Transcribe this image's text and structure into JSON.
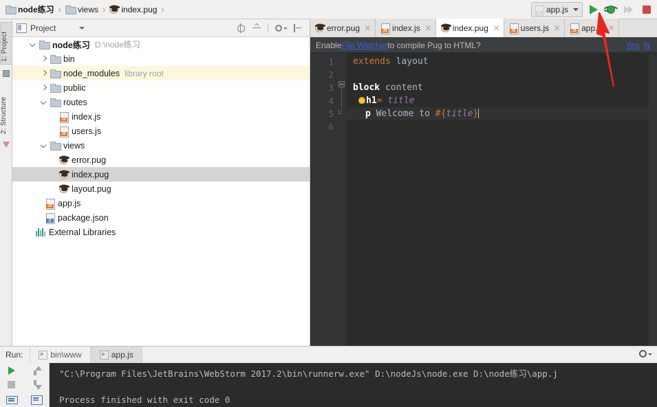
{
  "breadcrumb": {
    "items": [
      {
        "label": "node练习",
        "icon": "folder-icon",
        "bold": true
      },
      {
        "label": "views",
        "icon": "folder-icon",
        "bold": false
      },
      {
        "label": "index.pug",
        "icon": "pug-icon",
        "bold": false
      }
    ],
    "separator": "›"
  },
  "left_strip": {
    "project_tab": "1: Project",
    "structure_tab": "2: Structure"
  },
  "project_panel": {
    "title": "Project",
    "tools": [
      "locate-icon",
      "collapse-all-icon",
      "settings-gear-icon",
      "hide-icon"
    ],
    "tree": [
      {
        "label": "node练习",
        "sub": "D:\\node练习",
        "icon": "folder-icon",
        "arrow": "down",
        "indent": 0,
        "bold": true,
        "state": "normal"
      },
      {
        "label": "bin",
        "sub": "",
        "icon": "folder-icon",
        "arrow": "right",
        "indent": 1,
        "bold": false,
        "state": "normal"
      },
      {
        "label": "node_modules",
        "sub": "library root",
        "icon": "folder-icon",
        "arrow": "right",
        "indent": 1,
        "bold": false,
        "state": "highlight"
      },
      {
        "label": "public",
        "sub": "",
        "icon": "folder-icon",
        "arrow": "right",
        "indent": 1,
        "bold": false,
        "state": "normal"
      },
      {
        "label": "routes",
        "sub": "",
        "icon": "folder-icon",
        "arrow": "down",
        "indent": 1,
        "bold": false,
        "state": "normal"
      },
      {
        "label": "index.js",
        "sub": "",
        "icon": "js-icon",
        "arrow": "none",
        "indent": 2,
        "bold": false,
        "state": "normal"
      },
      {
        "label": "users.js",
        "sub": "",
        "icon": "js-icon",
        "arrow": "none",
        "indent": 2,
        "bold": false,
        "state": "normal"
      },
      {
        "label": "views",
        "sub": "",
        "icon": "folder-icon",
        "arrow": "down",
        "indent": 1,
        "bold": false,
        "state": "normal"
      },
      {
        "label": "error.pug",
        "sub": "",
        "icon": "pug-icon",
        "arrow": "none",
        "indent": 2,
        "bold": false,
        "state": "normal"
      },
      {
        "label": "index.pug",
        "sub": "",
        "icon": "pug-icon",
        "arrow": "none",
        "indent": 2,
        "bold": false,
        "state": "selected"
      },
      {
        "label": "layout.pug",
        "sub": "",
        "icon": "pug-icon",
        "arrow": "none",
        "indent": 2,
        "bold": false,
        "state": "normal"
      },
      {
        "label": "app.js",
        "sub": "",
        "icon": "js-icon",
        "arrow": "none",
        "indent": 1,
        "bold": false,
        "state": "normal"
      },
      {
        "label": "package.json",
        "sub": "",
        "icon": "json-icon",
        "arrow": "none",
        "indent": 1,
        "bold": false,
        "state": "normal"
      },
      {
        "label": "External Libraries",
        "sub": "",
        "icon": "library-icon",
        "arrow": "none",
        "indent": 0,
        "bold": false,
        "state": "normal"
      }
    ]
  },
  "run_toolbar": {
    "config_name": "app.js",
    "config_icon": "js-icon",
    "buttons": [
      {
        "name": "run-button",
        "icon": "play-icon",
        "enabled": true
      },
      {
        "name": "debug-button",
        "icon": "bug-icon",
        "enabled": true
      },
      {
        "name": "run-with-coverage-button",
        "icon": "fast-forward-icon",
        "enabled": false
      },
      {
        "name": "stop-button",
        "icon": "stop-icon",
        "enabled": true
      }
    ]
  },
  "editor": {
    "tabs": [
      {
        "label": "error.pug",
        "icon": "pug-icon",
        "active": false
      },
      {
        "label": "index.js",
        "icon": "js-icon",
        "active": false
      },
      {
        "label": "index.pug",
        "icon": "pug-icon",
        "active": true
      },
      {
        "label": "users.js",
        "icon": "js-icon",
        "active": false
      },
      {
        "label": "app.js",
        "icon": "js-icon",
        "active": false
      }
    ],
    "notification": {
      "prefix": "Enable ",
      "link": "File Watcher",
      "suffix": " to compile Pug to HTML?",
      "action_yes": "Yes",
      "action_no": "N"
    },
    "line_numbers": [
      "1",
      "2",
      "3",
      "4",
      "5",
      "6"
    ],
    "current_line": 5,
    "lines": [
      {
        "n": 1,
        "tokens": [
          {
            "t": "extends",
            "c": "kw-extends"
          },
          {
            "t": " layout",
            "c": "kw-plain"
          }
        ]
      },
      {
        "n": 2,
        "tokens": []
      },
      {
        "n": 3,
        "tokens": [
          {
            "t": "block",
            "c": "kw-block"
          },
          {
            "t": " content",
            "c": "kw-plain"
          }
        ]
      },
      {
        "n": 4,
        "tokens": [
          {
            "t": "h1",
            "c": "kw-tag"
          },
          {
            "t": "= ",
            "c": "kw-eq"
          },
          {
            "t": "title",
            "c": "kw-var"
          }
        ]
      },
      {
        "n": 5,
        "tokens": [
          {
            "t": "p",
            "c": "kw-tag"
          },
          {
            "t": " Welcome to ",
            "c": "kw-text"
          },
          {
            "t": "#{",
            "c": "kw-interp"
          },
          {
            "t": "title",
            "c": "kw-var"
          },
          {
            "t": "}",
            "c": "kw-interp"
          }
        ]
      },
      {
        "n": 6,
        "tokens": []
      }
    ]
  },
  "run_window": {
    "label": "Run:",
    "tabs": [
      {
        "label": "bin\\www",
        "active": false
      },
      {
        "label": "app.js",
        "active": true
      }
    ],
    "side_buttons": [
      "rerun-icon",
      "stop-icon",
      "print-icon",
      "up-icon",
      "down-icon",
      "soft-wrap-icon"
    ],
    "settings_icon": "gear-icon",
    "console_lines": [
      "\"C:\\Program Files\\JetBrains\\WebStorm 2017.2\\bin\\runnerw.exe\" D:\\nodeJs\\node.exe D:\\node练习\\app.j",
      "",
      "Process finished with exit code 0"
    ]
  },
  "annotation": {
    "arrow_color": "#e03020"
  }
}
